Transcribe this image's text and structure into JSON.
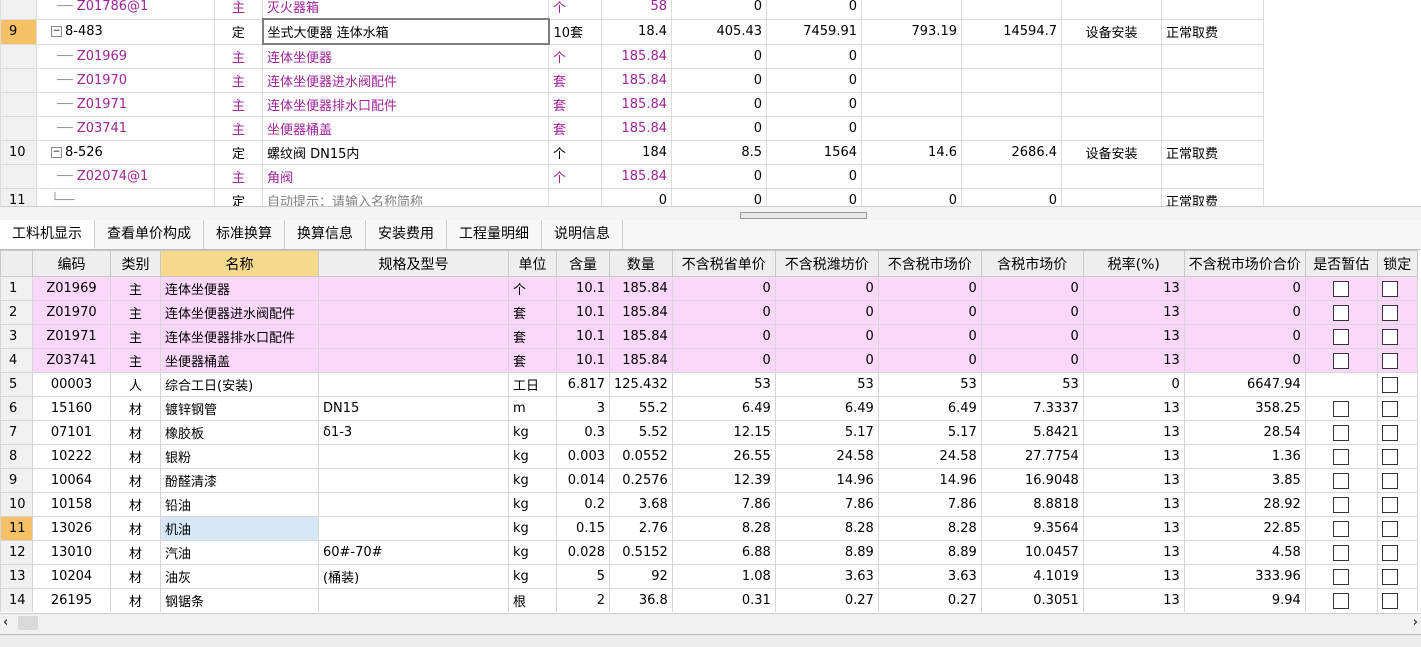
{
  "top_rows": [
    {
      "no": "",
      "code": "Z01786@1",
      "indent": 2,
      "type": "主",
      "name": "灭火器箱",
      "unit": "个",
      "qty": "58",
      "c1": "0",
      "c2": "0",
      "c3": "",
      "c4": "",
      "c5": "",
      "c6": "",
      "purple": true
    },
    {
      "no": "9",
      "code": "8-483",
      "indent": 0,
      "type": "定",
      "name": "坐式大便器 连体水箱",
      "unit": "10套",
      "qty": "18.4",
      "c1": "405.43",
      "c2": "7459.91",
      "c3": "793.19",
      "c4": "14594.7",
      "c5": "设备安装",
      "c6": "正常取费",
      "purple": false,
      "selected": true
    },
    {
      "no": "",
      "code": "Z01969",
      "indent": 1,
      "type": "主",
      "name": "连体坐便器",
      "unit": "个",
      "qty": "185.84",
      "c1": "0",
      "c2": "0",
      "c3": "",
      "c4": "",
      "c5": "",
      "c6": "",
      "purple": true
    },
    {
      "no": "",
      "code": "Z01970",
      "indent": 1,
      "type": "主",
      "name": "连体坐便器进水阀配件",
      "unit": "套",
      "qty": "185.84",
      "c1": "0",
      "c2": "0",
      "c3": "",
      "c4": "",
      "c5": "",
      "c6": "",
      "purple": true
    },
    {
      "no": "",
      "code": "Z01971",
      "indent": 1,
      "type": "主",
      "name": "连体坐便器排水口配件",
      "unit": "套",
      "qty": "185.84",
      "c1": "0",
      "c2": "0",
      "c3": "",
      "c4": "",
      "c5": "",
      "c6": "",
      "purple": true
    },
    {
      "no": "",
      "code": "Z03741",
      "indent": 1,
      "type": "主",
      "name": "坐便器桶盖",
      "unit": "套",
      "qty": "185.84",
      "c1": "0",
      "c2": "0",
      "c3": "",
      "c4": "",
      "c5": "",
      "c6": "",
      "purple": true
    },
    {
      "no": "10",
      "code": "8-526",
      "indent": 0,
      "type": "定",
      "name": "螺纹阀 DN15内",
      "unit": "个",
      "qty": "184",
      "c1": "8.5",
      "c2": "1564",
      "c3": "14.6",
      "c4": "2686.4",
      "c5": "设备安装",
      "c6": "正常取费",
      "purple": false
    },
    {
      "no": "",
      "code": "Z02074@1",
      "indent": 1,
      "type": "主",
      "name": "角阀",
      "unit": "个",
      "qty": "185.84",
      "c1": "0",
      "c2": "0",
      "c3": "",
      "c4": "",
      "c5": "",
      "c6": "",
      "purple": true
    },
    {
      "no": "11",
      "code": "",
      "indent": 0,
      "type": "定",
      "name": "自动提示：请输入名称简称",
      "unit": "",
      "qty": "0",
      "c1": "0",
      "c2": "0",
      "c3": "0",
      "c4": "0",
      "c5": "",
      "c6": "正常取费",
      "purple": false,
      "hint": true
    }
  ],
  "tabs": [
    "工料机显示",
    "查看单价构成",
    "标准换算",
    "换算信息",
    "安装费用",
    "工程量明细",
    "说明信息"
  ],
  "bottom_headers": [
    "编码",
    "类别",
    "名称",
    "规格及型号",
    "单位",
    "含量",
    "数量",
    "不含税省单价",
    "不含税潍坊价",
    "不含税市场价",
    "含税市场价",
    "税率(%)",
    "不含税市场价合价",
    "是否暂估",
    "锁定"
  ],
  "bottom_rows": [
    {
      "no": "1",
      "code": "Z01969",
      "type": "主",
      "name": "连体坐便器",
      "spec": "",
      "unit": "个",
      "content": "10.1",
      "qty": "185.84",
      "p1": "0",
      "p2": "0",
      "p3": "0",
      "p4": "0",
      "tax": "13",
      "total": "0",
      "est": true,
      "pink": true
    },
    {
      "no": "2",
      "code": "Z01970",
      "type": "主",
      "name": "连体坐便器进水阀配件",
      "spec": "",
      "unit": "套",
      "content": "10.1",
      "qty": "185.84",
      "p1": "0",
      "p2": "0",
      "p3": "0",
      "p4": "0",
      "tax": "13",
      "total": "0",
      "est": true,
      "pink": true
    },
    {
      "no": "3",
      "code": "Z01971",
      "type": "主",
      "name": "连体坐便器排水口配件",
      "spec": "",
      "unit": "套",
      "content": "10.1",
      "qty": "185.84",
      "p1": "0",
      "p2": "0",
      "p3": "0",
      "p4": "0",
      "tax": "13",
      "total": "0",
      "est": true,
      "pink": true
    },
    {
      "no": "4",
      "code": "Z03741",
      "type": "主",
      "name": "坐便器桶盖",
      "spec": "",
      "unit": "套",
      "content": "10.1",
      "qty": "185.84",
      "p1": "0",
      "p2": "0",
      "p3": "0",
      "p4": "0",
      "tax": "13",
      "total": "0",
      "est": true,
      "pink": true
    },
    {
      "no": "5",
      "code": "00003",
      "type": "人",
      "name": "综合工日(安装)",
      "spec": "",
      "unit": "工日",
      "content": "6.817",
      "qty": "125.432",
      "p1": "53",
      "p2": "53",
      "p3": "53",
      "p4": "53",
      "tax": "0",
      "total": "6647.94",
      "est": false
    },
    {
      "no": "6",
      "code": "15160",
      "type": "材",
      "name": "镀锌钢管",
      "spec": "DN15",
      "unit": "m",
      "content": "3",
      "qty": "55.2",
      "p1": "6.49",
      "p2": "6.49",
      "p3": "6.49",
      "p4": "7.3337",
      "tax": "13",
      "total": "358.25",
      "est": true
    },
    {
      "no": "7",
      "code": "07101",
      "type": "材",
      "name": "橡胶板",
      "spec": "δ1-3",
      "unit": "kg",
      "content": "0.3",
      "qty": "5.52",
      "p1": "12.15",
      "p2": "5.17",
      "p3": "5.17",
      "p4": "5.8421",
      "tax": "13",
      "total": "28.54",
      "est": true
    },
    {
      "no": "8",
      "code": "10222",
      "type": "材",
      "name": "银粉",
      "spec": "",
      "unit": "kg",
      "content": "0.003",
      "qty": "0.0552",
      "p1": "26.55",
      "p2": "24.58",
      "p3": "24.58",
      "p4": "27.7754",
      "tax": "13",
      "total": "1.36",
      "est": true
    },
    {
      "no": "9",
      "code": "10064",
      "type": "材",
      "name": "酚醛清漆",
      "spec": "",
      "unit": "kg",
      "content": "0.014",
      "qty": "0.2576",
      "p1": "12.39",
      "p2": "14.96",
      "p3": "14.96",
      "p4": "16.9048",
      "tax": "13",
      "total": "3.85",
      "est": true
    },
    {
      "no": "10",
      "code": "10158",
      "type": "材",
      "name": "铅油",
      "spec": "",
      "unit": "kg",
      "content": "0.2",
      "qty": "3.68",
      "p1": "7.86",
      "p2": "7.86",
      "p3": "7.86",
      "p4": "8.8818",
      "tax": "13",
      "total": "28.92",
      "est": true
    },
    {
      "no": "11",
      "code": "13026",
      "type": "材",
      "name": "机油",
      "spec": "",
      "unit": "kg",
      "content": "0.15",
      "qty": "2.76",
      "p1": "8.28",
      "p2": "8.28",
      "p3": "8.28",
      "p4": "9.3564",
      "tax": "13",
      "total": "22.85",
      "est": true,
      "selected": true
    },
    {
      "no": "12",
      "code": "13010",
      "type": "材",
      "name": "汽油",
      "spec": "60#-70#",
      "unit": "kg",
      "content": "0.028",
      "qty": "0.5152",
      "p1": "6.88",
      "p2": "8.89",
      "p3": "8.89",
      "p4": "10.0457",
      "tax": "13",
      "total": "4.58",
      "est": true
    },
    {
      "no": "13",
      "code": "10204",
      "type": "材",
      "name": "油灰",
      "spec": "(桶装)",
      "unit": "kg",
      "content": "5",
      "qty": "92",
      "p1": "1.08",
      "p2": "3.63",
      "p3": "3.63",
      "p4": "4.1019",
      "tax": "13",
      "total": "333.96",
      "est": true
    },
    {
      "no": "14",
      "code": "26195",
      "type": "材",
      "name": "钢锯条",
      "spec": "",
      "unit": "根",
      "content": "2",
      "qty": "36.8",
      "p1": "0.31",
      "p2": "0.27",
      "p3": "0.27",
      "p4": "0.3051",
      "tax": "13",
      "total": "9.94",
      "est": true
    }
  ]
}
